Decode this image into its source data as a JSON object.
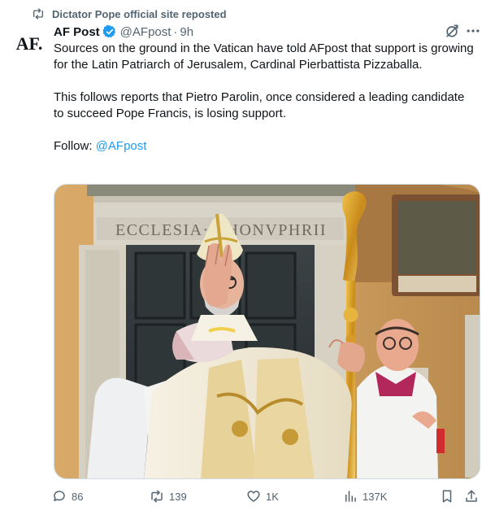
{
  "repost": {
    "text": "Dictator Pope official site reposted"
  },
  "author": {
    "avatar_text": "AF.",
    "name": "AF Post",
    "handle": "@AFpost",
    "separator": "·",
    "time": "9h"
  },
  "tweet": {
    "paragraph1": "Sources on the ground in the Vatican have told AFpost that support is growing for the Latin Patriarch of Jerusalem, Cardinal Pierbattista Pizzaballa.",
    "paragraph2": "This follows reports that Pietro Parolin, once considered a leading candidate to succeed Pope Francis, is losing support.",
    "follow_label": "Follow: ",
    "follow_mention": "@AFpost"
  },
  "media": {
    "inscription": "ECCLESIA·S·HONVPHRII"
  },
  "actions": {
    "replies": "86",
    "reposts": "139",
    "likes": "1K",
    "views": "137K"
  },
  "colors": {
    "accent": "#1d9bf0",
    "muted": "#536471",
    "text": "#0f1419"
  },
  "icons": [
    "repost-icon",
    "verified-badge-icon",
    "grok-icon",
    "more-icon",
    "reply-icon",
    "like-icon",
    "views-icon",
    "bookmark-icon",
    "share-icon"
  ]
}
